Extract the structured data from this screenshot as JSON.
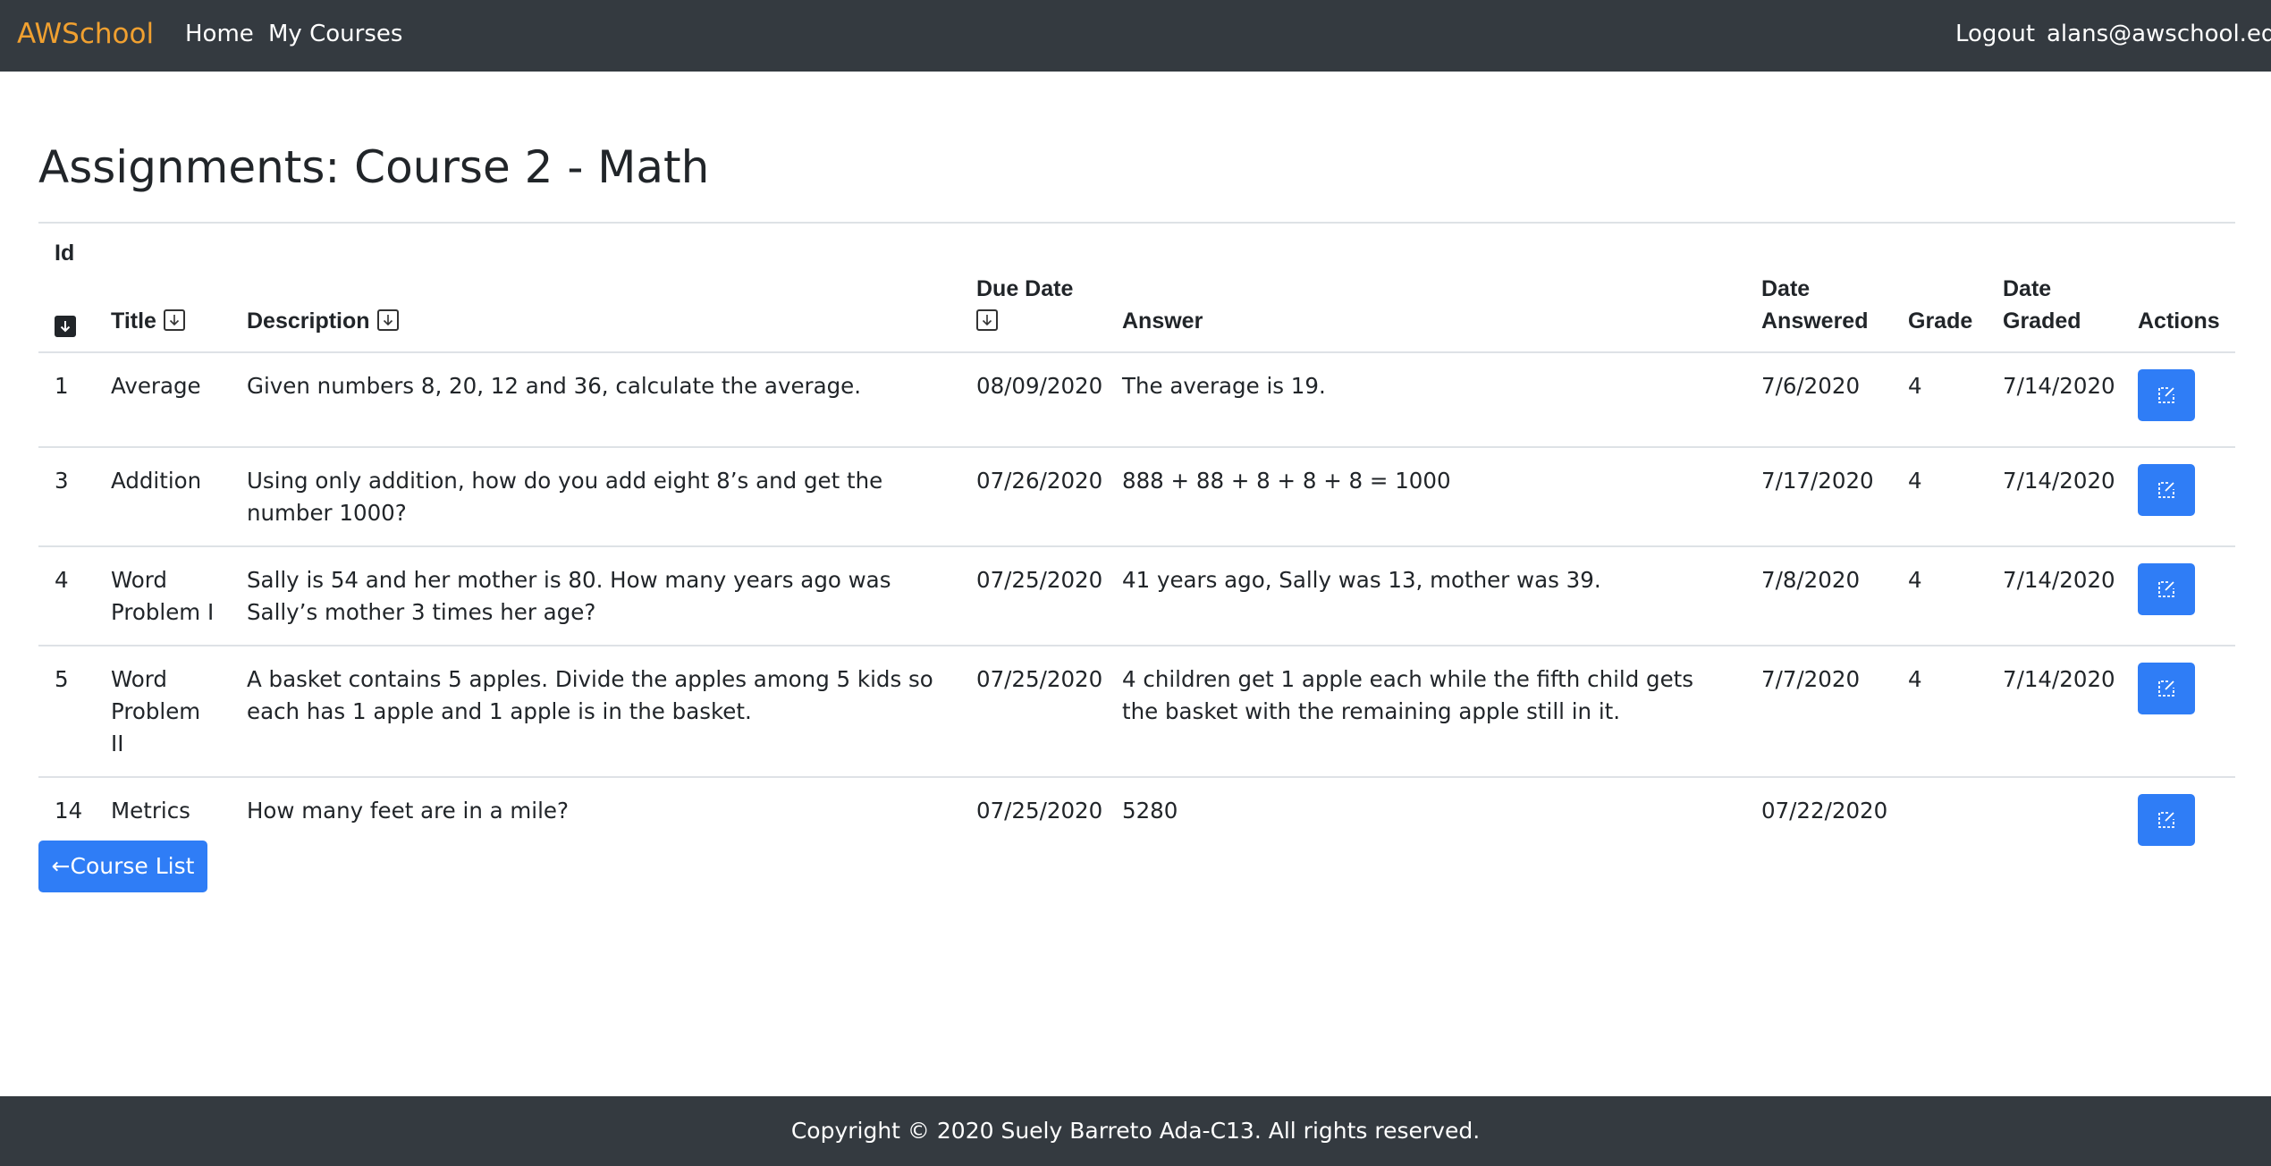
{
  "navbar": {
    "brand": "AWSchool",
    "links": {
      "home": "Home",
      "my_courses": "My Courses"
    },
    "logout": "Logout",
    "user_email": "alans@awschool.edu",
    "brand_color": "#f0a030",
    "background": "#343a40"
  },
  "page": {
    "title": "Assignments: Course 2 - Math"
  },
  "table": {
    "headers": {
      "id": "Id",
      "title": "Title",
      "description": "Description",
      "due_date": "Due Date",
      "answer": "Answer",
      "date_answered_1": "Date",
      "date_answered_2": "Answered",
      "grade": "Grade",
      "date_graded_1": "Date",
      "date_graded_2": "Graded",
      "actions": "Actions"
    },
    "sort_icons": {
      "id": "sort-down-active-icon",
      "title": "sort-down-icon",
      "description": "sort-down-icon",
      "due_date": "sort-down-icon"
    },
    "rows": [
      {
        "id": "1",
        "title": "Average",
        "description": "Given numbers 8, 20, 12 and 36, calculate the average.",
        "due_date": "08/09/2020",
        "answer": "The average is 19.",
        "date_answered": "7/6/2020",
        "grade": "4",
        "date_graded": "7/14/2020",
        "action_icon": "edit-icon"
      },
      {
        "id": "3",
        "title": "Addition",
        "description": "Using only addition, how do you add eight 8’s and get the number 1000?",
        "due_date": "07/26/2020",
        "answer": "888 + 88 + 8 + 8 + 8 = 1000",
        "date_answered": "7/17/2020",
        "grade": "4",
        "date_graded": "7/14/2020",
        "action_icon": "edit-icon"
      },
      {
        "id": "4",
        "title": "Word Problem I",
        "description": "Sally is 54 and her mother is 80. How many years ago was Sally’s mother 3 times her age?",
        "due_date": "07/25/2020",
        "answer": "41 years ago, Sally was 13, mother was 39.",
        "date_answered": "7/8/2020",
        "grade": "4",
        "date_graded": "7/14/2020",
        "action_icon": "edit-icon"
      },
      {
        "id": "5",
        "title": "Word Problem II",
        "description": "A basket contains 5 apples. Divide the apples among 5 kids so each has 1 apple and 1 apple is in the basket.",
        "due_date": "07/25/2020",
        "answer": "4 children get 1 apple each while the fifth child gets the basket with the remaining apple still in it.",
        "date_answered": "7/7/2020",
        "grade": "4",
        "date_graded": "7/14/2020",
        "action_icon": "edit-icon"
      },
      {
        "id": "14",
        "title": "Metrics",
        "description": "How many feet are in a mile?",
        "due_date": "07/25/2020",
        "answer": "5280",
        "date_answered": "07/22/2020",
        "grade": "",
        "date_graded": "",
        "action_icon": "edit-icon"
      }
    ]
  },
  "back_button": {
    "label": "←Course List",
    "color": "#2f7df6"
  },
  "footer": {
    "text": "Copyright © 2020 Suely Barreto Ada-C13. All rights reserved."
  }
}
